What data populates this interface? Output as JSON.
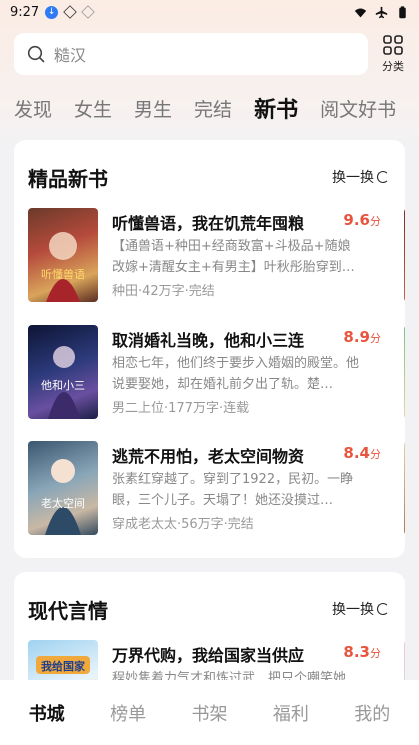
{
  "status_bar": {
    "time": "9:27"
  },
  "search": {
    "placeholder": "糙汉"
  },
  "category": {
    "label": "分类"
  },
  "tabs": [
    {
      "label": "发现",
      "active": false
    },
    {
      "label": "女生",
      "active": false
    },
    {
      "label": "男生",
      "active": false
    },
    {
      "label": "完结",
      "active": false
    },
    {
      "label": "新书",
      "active": true
    },
    {
      "label": "阅文好书",
      "active": false
    }
  ],
  "section1": {
    "title": "精品新书",
    "refresh_label": "换一换",
    "books": [
      {
        "title": "听懂兽语，我在饥荒年囤粮",
        "score": "9.6",
        "score_unit": "分",
        "desc": "【通兽语+种田+经商致富+斗极品+随娘改嫁+清醒女主+有男主】叶秋彤胎穿到…",
        "meta": "种田·42万字·完结",
        "cover_text": "听懂兽语"
      },
      {
        "title": "取消婚礼当晚，他和小三连",
        "score": "8.9",
        "score_unit": "分",
        "desc": "相恋七年，他们终于要步入婚姻的殿堂。他说要娶她，却在婚礼前夕出了轨。楚…",
        "meta": "男二上位·177万字·连载",
        "cover_text": "他和小三"
      },
      {
        "title": "逃荒不用怕，老太空间物资",
        "score": "8.4",
        "score_unit": "分",
        "desc": "张素红穿越了。穿到了1922，民初。一睁眼，三个儿子。天塌了！她还没摸过…",
        "meta": "穿成老太太·56万字·完结",
        "cover_text": "老太空间"
      }
    ]
  },
  "section2": {
    "title": "现代言情",
    "refresh_label": "换一换",
    "books": [
      {
        "title": "万界代购，我给国家当供应",
        "score": "8.3",
        "score_unit": "分",
        "desc": "程妙隽着力气才和炼过武…把只个嘲笑她…",
        "meta": "",
        "cover_text": "我给国家"
      }
    ]
  },
  "bottom_nav": [
    {
      "label": "书城",
      "active": true
    },
    {
      "label": "榜单",
      "active": false
    },
    {
      "label": "书架",
      "active": false
    },
    {
      "label": "福利",
      "active": false
    },
    {
      "label": "我的",
      "active": false
    }
  ],
  "colors": {
    "score": "#e8553f",
    "accent_bg": "#fbece4"
  }
}
